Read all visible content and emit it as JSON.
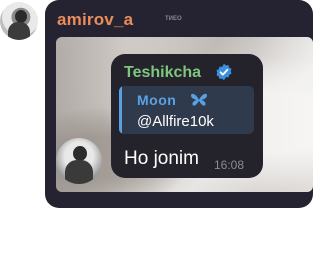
{
  "sender": {
    "name": "amirov_a",
    "tag": "ТИЕО",
    "name_color": "#e88d5b"
  },
  "forwarded_card": {
    "name": "Teshikcha",
    "name_color": "#7ec77e",
    "verified_icon": "verified-badge-icon",
    "reply": {
      "name": "Moon",
      "icon": "butterfly-icon",
      "text": "@Allfire10k",
      "accent_color": "#5aa1e3"
    },
    "message": "Ho jonim",
    "time": "16:08"
  },
  "colors": {
    "bubble": "#252331",
    "card": "#24232b",
    "reply_bg": "#2f3b4d"
  }
}
